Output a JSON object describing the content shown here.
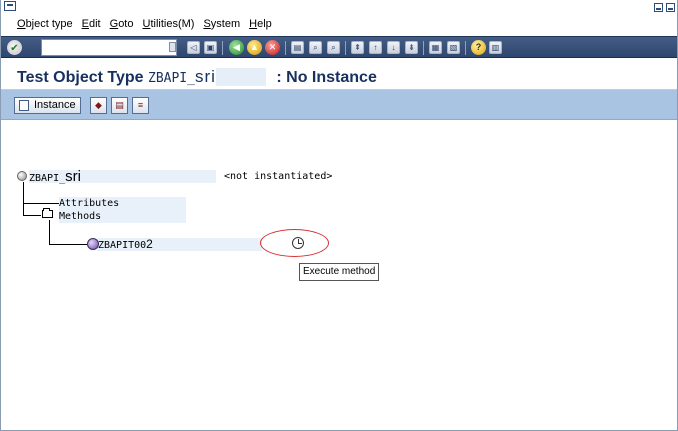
{
  "menubar": {
    "items": [
      "Object type",
      "Edit",
      "Goto",
      "Utilities(M)",
      "System",
      "Help"
    ]
  },
  "toolbar": {
    "command_value": ""
  },
  "title": {
    "prefix": "Test Object Type",
    "object_code": "ZBAPI_",
    "object_name": "sri",
    "suffix": ": No Instance"
  },
  "app_toolbar": {
    "instance_label": "Instance"
  },
  "tree": {
    "root": {
      "code": "ZBAPI_",
      "name": "sri",
      "status": "<not instantiated>"
    },
    "attributes_label": "Attributes",
    "methods_label": "Methods",
    "method": {
      "code": "ZBAPIT00",
      "suffix": "2"
    }
  },
  "tooltip": {
    "text": "Execute method"
  },
  "colors": {
    "toolbar_bg": "#3b5479",
    "app_toolbar_bg": "#a9c3e2",
    "title_color": "#18305e",
    "highlight_row": "#e8f0fa",
    "ring": "#d93030"
  }
}
